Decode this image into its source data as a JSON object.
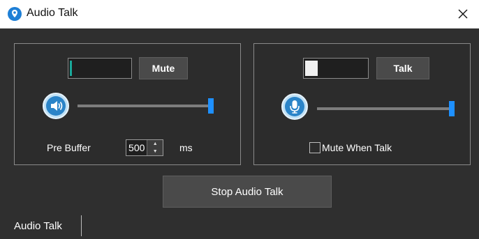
{
  "window": {
    "title": "Audio Talk",
    "close_glyph": "✕"
  },
  "left_panel": {
    "mute_button": "Mute",
    "level_fraction": 0.03,
    "volume_icon": "speaker-icon",
    "volume_level": 1.0,
    "pre_buffer_label": "Pre Buffer",
    "pre_buffer_value": "500",
    "pre_buffer_unit": "ms"
  },
  "right_panel": {
    "talk_button": "Talk",
    "level_fraction": 0.2,
    "mic_icon": "microphone-icon",
    "mic_level": 1.0,
    "mute_when_talk_label": "Mute When Talk",
    "mute_when_talk_checked": false
  },
  "actions": {
    "stop_label": "Stop Audio Talk"
  },
  "statusbar": {
    "text": "Audio Talk"
  },
  "colors": {
    "accent": "#1e90ff",
    "level_teal": "#1aa89a",
    "level_white": "#f0f0f0"
  }
}
